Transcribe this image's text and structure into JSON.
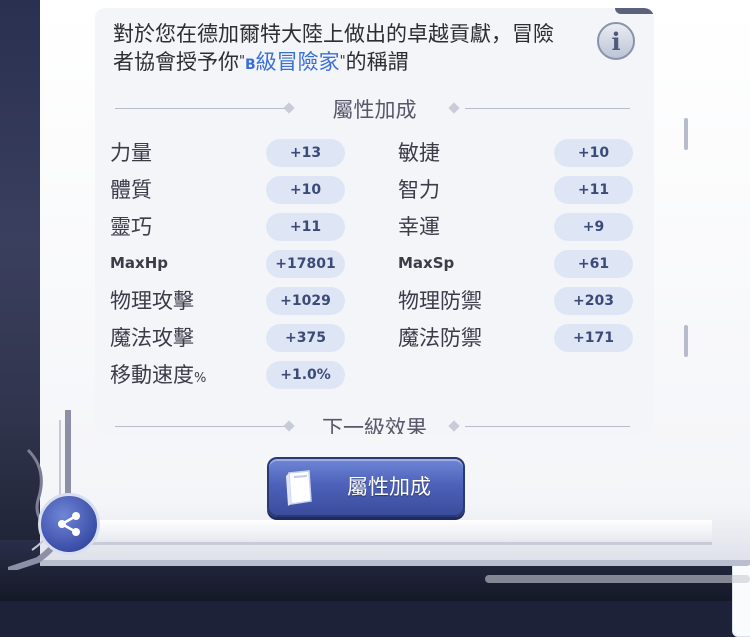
{
  "description": {
    "line1": "對於您在德加爾特大陸上做出的卓越貢獻，冒險",
    "line2_prefix": "者協會授予你",
    "title_prefix": "B",
    "title_name": "級冒險家",
    "line2_suffix": "的稱謂"
  },
  "section_header": "屬性加成",
  "next_level_header": "下一級效果",
  "stats": [
    {
      "label": "力量",
      "value": "+13"
    },
    {
      "label": "敏捷",
      "value": "+10"
    },
    {
      "label": "體質",
      "value": "+10"
    },
    {
      "label": "智力",
      "value": "+11"
    },
    {
      "label": "靈巧",
      "value": "+11"
    },
    {
      "label": "幸運",
      "value": "+9"
    },
    {
      "label": "MaxHp",
      "value": "+17801"
    },
    {
      "label": "MaxSp",
      "value": "+61"
    },
    {
      "label": "物理攻擊",
      "value": "+1029"
    },
    {
      "label": "物理防禦",
      "value": "+203"
    },
    {
      "label": "魔法攻擊",
      "value": "+375"
    },
    {
      "label": "魔法防禦",
      "value": "+171"
    },
    {
      "label": "移動速度",
      "label_suffix": "%",
      "value": "+1.0%"
    }
  ],
  "button_label": "屬性加成",
  "icons": {
    "info": "info-icon",
    "book": "book-icon",
    "share": "share-icon"
  },
  "colors": {
    "accent_title": "#3a6fd8",
    "button": "#4d62b9",
    "pill": "#dee6f6"
  }
}
